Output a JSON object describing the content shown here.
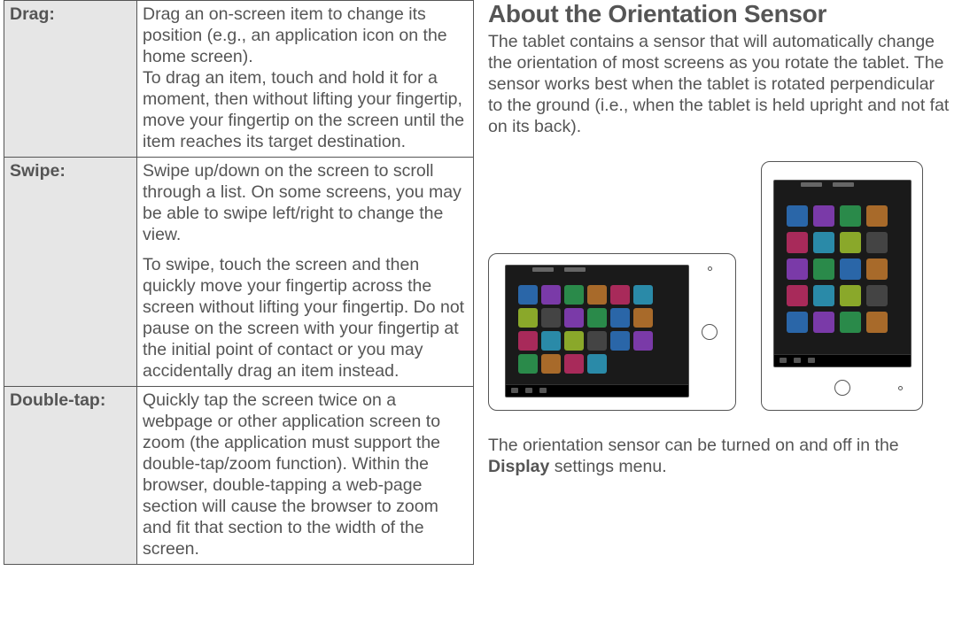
{
  "table": {
    "rows": [
      {
        "label": "Drag:",
        "paras": [
          "Drag an on-screen item to change its position (e.g., an application icon on the home screen).\nTo drag an item, touch and hold it for a moment, then without lifting your fingertip, move your fingertip on the screen until the item reaches its target destination."
        ]
      },
      {
        "label": "Swipe:",
        "paras": [
          "Swipe up/down on the screen to scroll through a list. On some screens, you may be able to swipe left/right to change the view.",
          "To swipe, touch the screen and then quickly move your fingertip across the screen without lifting your fingertip. Do not pause on the screen with your fingertip at the initial point of contact or you may accidentally drag an item instead."
        ]
      },
      {
        "label": "Double-tap:",
        "paras": [
          "Quickly tap the screen twice on a webpage or other application screen to zoom (the application must support the double-tap/zoom function). Within the browser, double-tapping a web-page section will cause the browser to zoom and fit that section to the width of the screen."
        ]
      }
    ]
  },
  "heading": "About the Orientation Sensor",
  "intro": "The tablet contains a sensor that will automatically change the orientation of most screens as you rotate the tablet. The sensor works best when the tablet is rotated perpendicular to the ground (i.e., when the tablet is held upright and not fat on its back).",
  "outro_pre": "The orientation sensor can be turned on and off in the ",
  "outro_bold": "Display",
  "outro_post": " settings menu."
}
